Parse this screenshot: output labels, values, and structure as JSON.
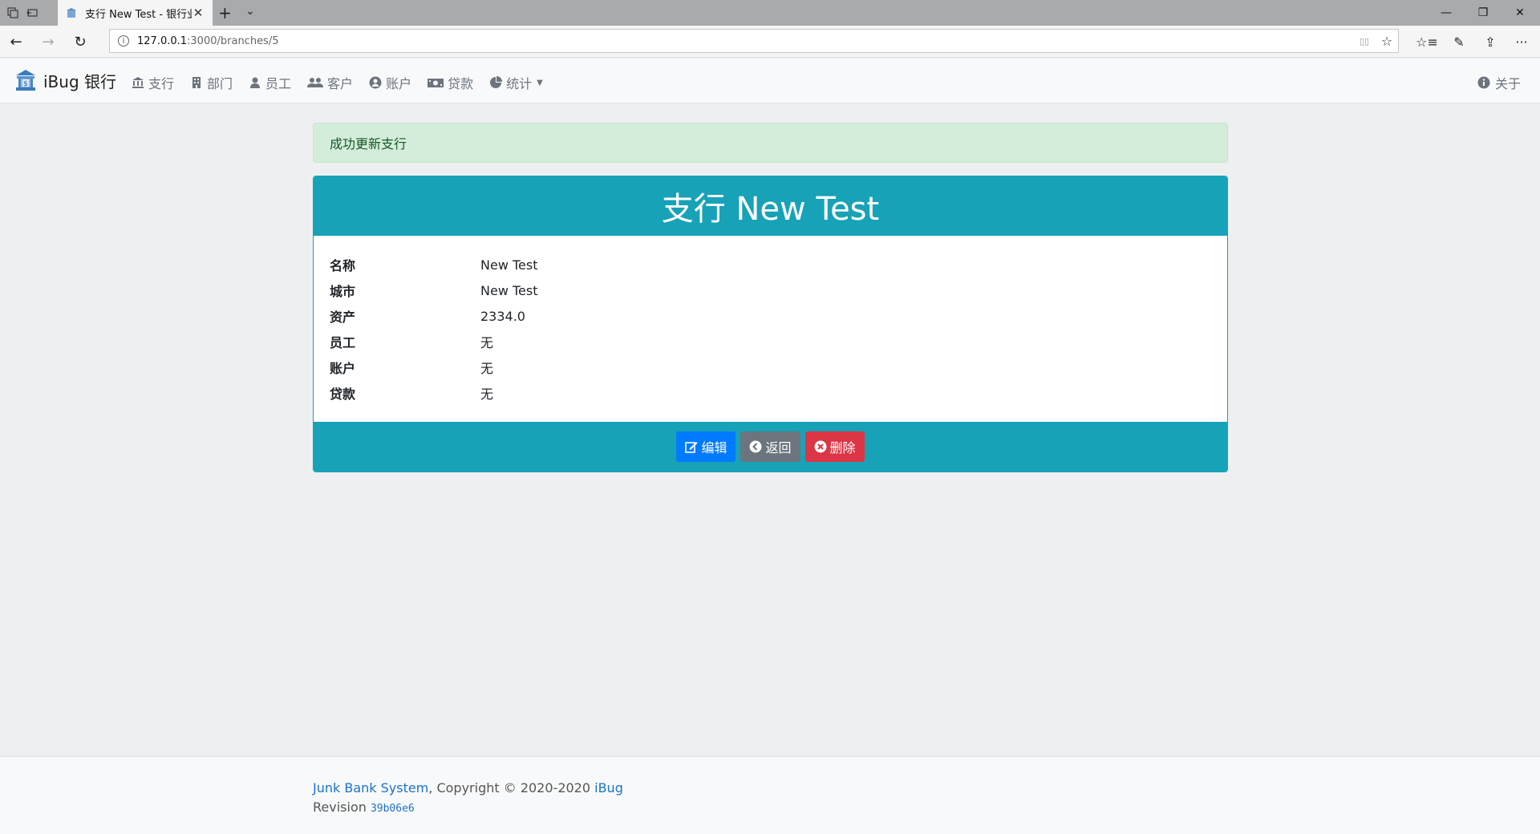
{
  "browser": {
    "tab_title": "支行 New Test - 银行业!",
    "tab_close": "✕",
    "new_tab": "+",
    "tab_list": "⌄",
    "window": {
      "minimize": "—",
      "restore": "❐",
      "close": "✕"
    },
    "nav": {
      "back": "←",
      "forward": "→",
      "refresh": "↻"
    },
    "url_host": "127.0.0.1",
    "url_path": ":3000/branches/5",
    "url_info": "i",
    "reading_view": "▯▯",
    "favorite": "☆",
    "tools": {
      "favorites": "☆≡",
      "pen": "✎",
      "share": "⇪",
      "more": "···"
    }
  },
  "app": {
    "brand": "iBug 银行",
    "nav": [
      {
        "label": "支行",
        "icon": "bank-icon"
      },
      {
        "label": "部门",
        "icon": "building-icon"
      },
      {
        "label": "员工",
        "icon": "user-icon"
      },
      {
        "label": "客户",
        "icon": "users-icon"
      },
      {
        "label": "账户",
        "icon": "user-circle-icon"
      },
      {
        "label": "贷款",
        "icon": "money-icon"
      },
      {
        "label": "统计",
        "icon": "pie-chart-icon",
        "dropdown": true
      }
    ],
    "about": "关于"
  },
  "alert": {
    "text": "成功更新支行"
  },
  "card": {
    "title": "支行 New Test",
    "fields": [
      {
        "label": "名称",
        "value": "New Test"
      },
      {
        "label": "城市",
        "value": "New Test"
      },
      {
        "label": "资产",
        "value": "2334.0"
      },
      {
        "label": "员工",
        "value": "无"
      },
      {
        "label": "账户",
        "value": "无"
      },
      {
        "label": "贷款",
        "value": "无"
      }
    ],
    "buttons": {
      "edit": "编辑",
      "back": "返回",
      "delete": "删除"
    }
  },
  "footer": {
    "system_link": "Junk Bank System",
    "copyright": ", Copyright © 2020-2020 ",
    "author_link": "iBug",
    "revision_label": "Revision ",
    "revision": "39b06e6"
  },
  "colors": {
    "primary_teal": "#17a2b8",
    "alert_bg": "#d4edda",
    "edit": "#007bff",
    "back": "#6c757d",
    "delete": "#dc3545",
    "link": "#1a73c9"
  }
}
